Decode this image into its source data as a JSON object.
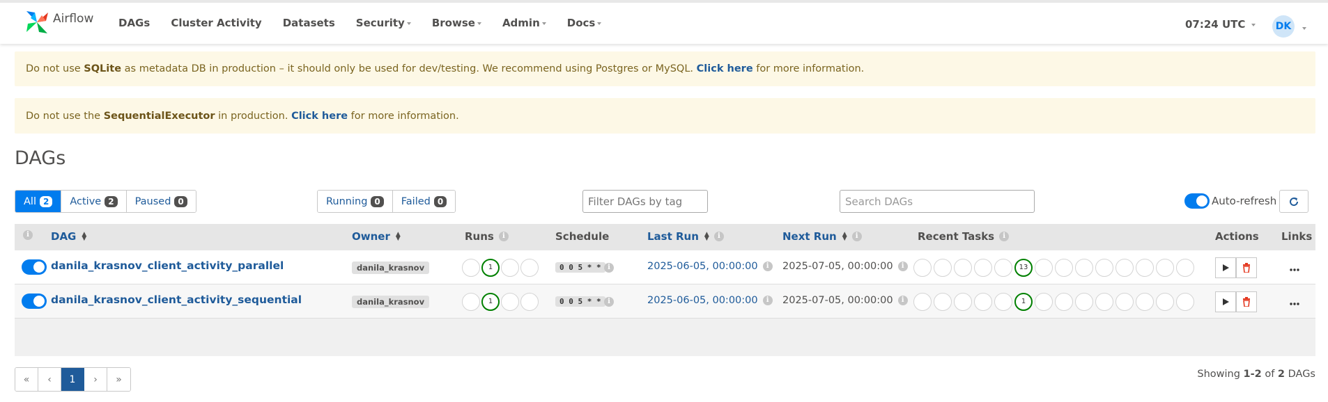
{
  "brand": {
    "name": "Airflow"
  },
  "nav": {
    "items": [
      {
        "label": "DAGs",
        "dropdown": false
      },
      {
        "label": "Cluster Activity",
        "dropdown": false
      },
      {
        "label": "Datasets",
        "dropdown": false
      },
      {
        "label": "Security",
        "dropdown": true
      },
      {
        "label": "Browse",
        "dropdown": true
      },
      {
        "label": "Admin",
        "dropdown": true
      },
      {
        "label": "Docs",
        "dropdown": true
      }
    ],
    "clock": "07:24 UTC",
    "avatar": "DK"
  },
  "alerts": {
    "sqlite": {
      "pre": "Do not use ",
      "strong": "SQLite",
      "mid": " as metadata DB in production – it should only be used for dev/testing. We recommend using Postgres or MySQL. ",
      "link": "Click here",
      "post": " for more information."
    },
    "executor": {
      "pre": "Do not use the ",
      "strong": "SequentialExecutor",
      "mid": " in production. ",
      "link": "Click here",
      "post": " for more information."
    }
  },
  "page": {
    "title": "DAGs"
  },
  "filters": {
    "status": [
      {
        "label": "All",
        "count": "2",
        "active": true
      },
      {
        "label": "Active",
        "count": "2",
        "active": false
      },
      {
        "label": "Paused",
        "count": "0",
        "active": false
      }
    ],
    "runs": [
      {
        "label": "Running",
        "count": "0"
      },
      {
        "label": "Failed",
        "count": "0"
      }
    ],
    "tag_placeholder": "Filter DAGs by tag",
    "search_placeholder": "Search DAGs",
    "autorefresh_label": "Auto-refresh"
  },
  "table": {
    "headers": {
      "dag": "DAG",
      "owner": "Owner",
      "runs": "Runs",
      "schedule": "Schedule",
      "last_run": "Last Run",
      "next_run": "Next Run",
      "recent_tasks": "Recent Tasks",
      "actions": "Actions",
      "links": "Links"
    },
    "rows": [
      {
        "dag_id": "danila_krasnov_client_activity_parallel",
        "owner": "danila_krasnov",
        "runs_success": "1",
        "schedule": "0 0 5 * *",
        "last_run": "2025-06-05, 00:00:00",
        "next_run": "2025-07-05, 00:00:00",
        "tasks_success": "13"
      },
      {
        "dag_id": "danila_krasnov_client_activity_sequential",
        "owner": "danila_krasnov",
        "runs_success": "1",
        "schedule": "0 0 5 * *",
        "last_run": "2025-06-05, 00:00:00",
        "next_run": "2025-07-05, 00:00:00",
        "tasks_success": "1"
      }
    ]
  },
  "pagination": {
    "first": "«",
    "prev": "‹",
    "current": "1",
    "next": "›",
    "last": "»"
  },
  "showing": {
    "pre": "Showing ",
    "range": "1-2",
    "mid": " of ",
    "total": "2",
    "post": " DAGs"
  },
  "colors": {
    "primary": "#017cee",
    "link": "#1f5b9a",
    "success": "#008000",
    "alert_bg": "#fdf8e6",
    "delete": "#e43921"
  }
}
